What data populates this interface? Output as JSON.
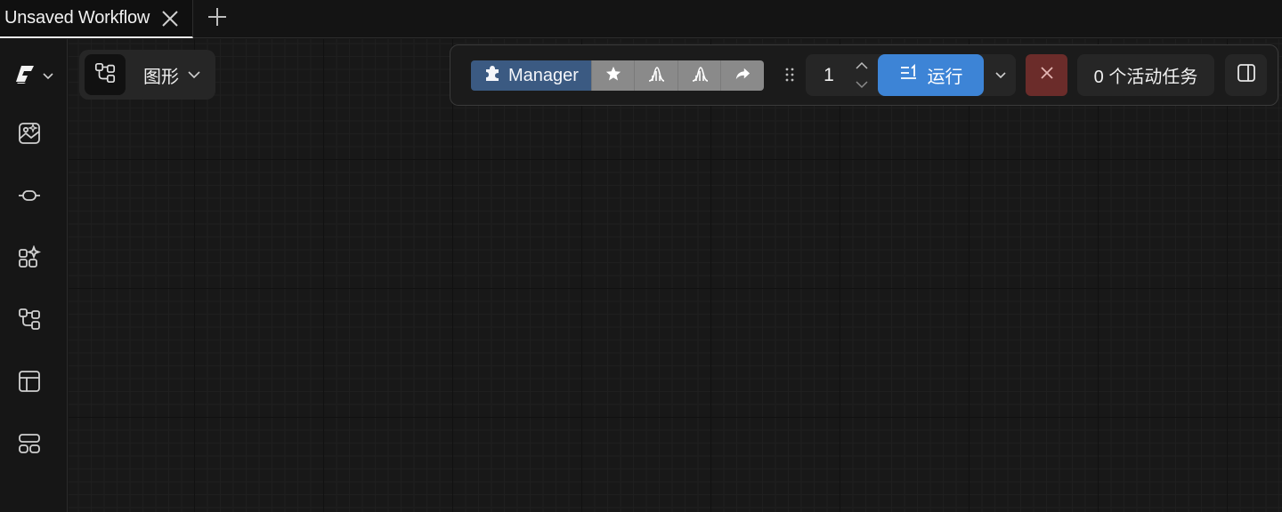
{
  "tabs": {
    "active_title": "Unsaved Workflow"
  },
  "graph_selector": {
    "label": "图形"
  },
  "toolbar": {
    "manager_label": "Manager",
    "batch_count": "1",
    "run_label": "运行",
    "active_tasks_label": "0 个活动任务"
  },
  "colors": {
    "accent_blue": "#3d84d6",
    "manager_blue": "#3b5a82",
    "stop_red": "#6b2c2a",
    "background": "#171717"
  },
  "icons": {
    "rail": [
      "comfy-logo",
      "image-icon",
      "model-node-icon",
      "node-library-icon",
      "workflow-icon",
      "template-icon",
      "queue-layout-icon"
    ],
    "toolbar": [
      "puzzle-icon",
      "star-icon",
      "bell-curve-icon",
      "bell-curve-icon",
      "share-icon"
    ]
  }
}
